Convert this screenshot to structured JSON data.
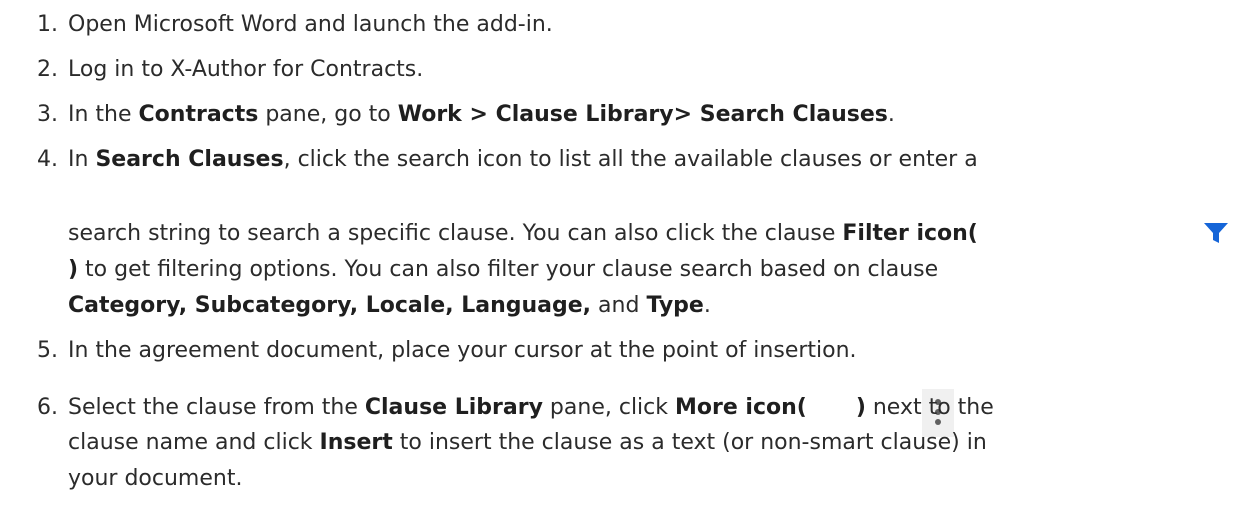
{
  "steps": [
    {
      "num": "1.",
      "parts": [
        {
          "t": "Open Microsoft Word and launch the add-in.",
          "b": false
        }
      ]
    },
    {
      "num": "2.",
      "parts": [
        {
          "t": "Log in to X-Author for Contracts.",
          "b": false
        }
      ]
    },
    {
      "num": "3.",
      "parts": [
        {
          "t": "In the ",
          "b": false
        },
        {
          "t": "Contracts",
          "b": true
        },
        {
          "t": " pane, go to ",
          "b": false
        },
        {
          "t": "Work > Clause Library> Search Clauses",
          "b": true
        },
        {
          "t": ".",
          "b": false
        }
      ]
    },
    {
      "num": "4.",
      "parts": [
        {
          "t": "In ",
          "b": false
        },
        {
          "t": "Search Clauses",
          "b": true
        },
        {
          "t": ", click the search icon to list all the available clauses or enter a",
          "b": false
        }
      ],
      "lines": [
        [
          {
            "t": "search string to search a specific clause. You can also click the clause ",
            "b": false
          },
          {
            "t": "Filter icon(",
            "b": true
          }
        ],
        [
          {
            "t": ")",
            "b": true
          },
          {
            "t": " to get filtering options. You can also filter your clause search based on clause",
            "b": false
          }
        ],
        [
          {
            "t": "Category, Subcategory, Locale, Language,",
            "b": true
          },
          {
            "t": " and ",
            "b": false
          },
          {
            "t": "Type",
            "b": true
          },
          {
            "t": ".",
            "b": false
          }
        ]
      ]
    },
    {
      "num": "5.",
      "parts": [
        {
          "t": "In the agreement document, place your cursor at the point of insertion.",
          "b": false
        }
      ]
    },
    {
      "num": "6.",
      "parts": [
        {
          "t": "Select the clause from the ",
          "b": false
        },
        {
          "t": "Clause Library",
          "b": true
        },
        {
          "t": " pane, click ",
          "b": false
        },
        {
          "t": "More icon(",
          "b": true
        },
        {
          "t": "       ",
          "b": false
        },
        {
          "t": ")",
          "b": true
        },
        {
          "t": " next to the",
          "b": false
        }
      ],
      "lines": [
        [
          {
            "t": "clause name and click ",
            "b": false
          },
          {
            "t": "Insert",
            "b": true
          },
          {
            "t": " to insert the clause as a text (or non-smart clause) in",
            "b": false
          }
        ],
        [
          {
            "t": "your document.",
            "b": false
          }
        ]
      ]
    }
  ],
  "icons": {
    "filter_color": "#1565d8",
    "more_color": "#606060"
  }
}
